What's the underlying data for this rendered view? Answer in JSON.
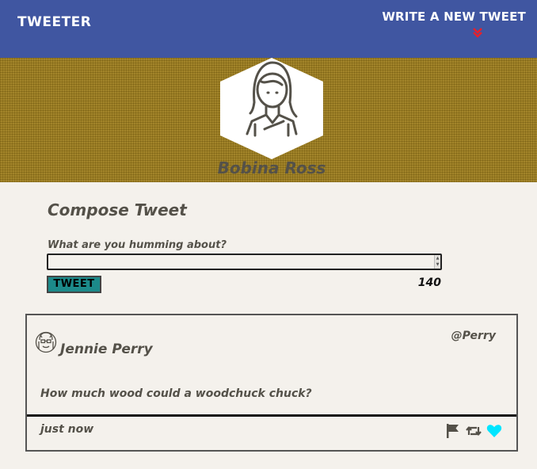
{
  "nav": {
    "brand": "Tweeter",
    "compose_toggle": "Write a new tweet",
    "toggle_icon": "double-chevron-down-icon"
  },
  "profile": {
    "name": "Bobina Ross",
    "avatar_icon": "woman-avatar-icon"
  },
  "compose": {
    "title": "Compose Tweet",
    "prompt": "What are you humming about?",
    "input_value": "",
    "button_label": "Tweet",
    "counter": "140"
  },
  "tweets": [
    {
      "author": "Jennie Perry",
      "handle": "@Perry",
      "text": "How much wood could a woodchuck chuck?",
      "time": "just now",
      "avatar_icon": "robot-avatar-icon",
      "actions": [
        "flag-icon",
        "retweet-icon",
        "heart-icon"
      ],
      "liked": true
    }
  ],
  "colors": {
    "nav": "#4056a1",
    "banner": "#9b7b1a",
    "page": "#f4f1ec",
    "text": "#545149",
    "button": "#1c8a8a",
    "chevron": "#e8202a",
    "heart": "#00e5ff"
  }
}
